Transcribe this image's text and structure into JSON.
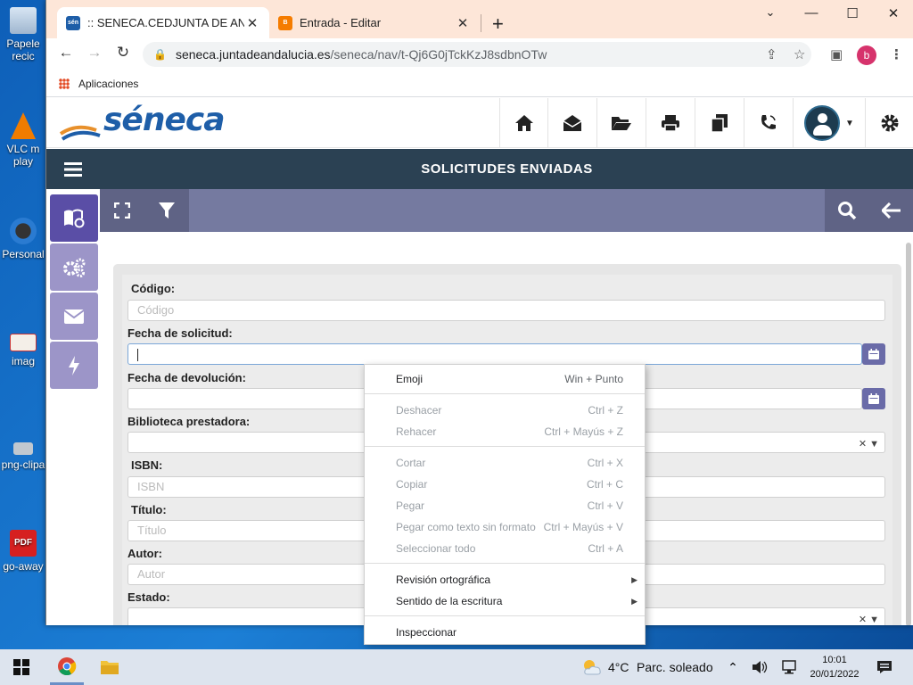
{
  "desktop": {
    "icons": [
      {
        "label": "Papele\nrecic",
        "name": "recycle-bin"
      },
      {
        "label": "VLC m\nplay",
        "name": "vlc-player"
      },
      {
        "label": "Personal",
        "name": "personal"
      },
      {
        "label": "imag",
        "name": "image-file"
      },
      {
        "label": "png-clipa",
        "name": "png-clipart"
      },
      {
        "label": "go-away",
        "name": "pdf-file"
      }
    ]
  },
  "browser": {
    "tabs": [
      {
        "favicon": "sén",
        "title": ":: SENECA.CEDJUNTA DE ANDALUCÍA",
        "active": true
      },
      {
        "favicon": "",
        "title": "Entrada - Editar",
        "active": false
      }
    ],
    "url_host": "seneca.juntadeandalucia.es",
    "url_path": "/seneca/nav/t-Qj6G0jTckKzJ8sdbnOTw",
    "bookmarks_label": "Aplicaciones",
    "profile_initial": "b"
  },
  "app": {
    "logo_text": "séneca",
    "page_title": "SOLICITUDES ENVIADAS",
    "colors": {
      "header_dark": "#2b4153",
      "action_bar": "#757aa0",
      "side_active": "#5a4ea6",
      "side_item": "#9c95c8"
    },
    "form": {
      "codigo_label": "Código:",
      "codigo_placeholder": "Código",
      "fecha_solicitud_label": "Fecha de solicitud:",
      "fecha_devolucion_label": "Fecha de devolución:",
      "biblioteca_label": "Biblioteca prestadora:",
      "isbn_label": "ISBN:",
      "isbn_placeholder": "ISBN",
      "titulo_label": "Título:",
      "titulo_placeholder": "Título",
      "autor_label": "Autor:",
      "autor_placeholder": "Autor",
      "estado_label": "Estado:"
    }
  },
  "context_menu": {
    "emoji": {
      "label": "Emoji",
      "shortcut": "Win + Punto"
    },
    "deshacer": {
      "label": "Deshacer",
      "shortcut": "Ctrl + Z"
    },
    "rehacer": {
      "label": "Rehacer",
      "shortcut": "Ctrl + Mayús + Z"
    },
    "cortar": {
      "label": "Cortar",
      "shortcut": "Ctrl + X"
    },
    "copiar": {
      "label": "Copiar",
      "shortcut": "Ctrl + C"
    },
    "pegar": {
      "label": "Pegar",
      "shortcut": "Ctrl + V"
    },
    "pegar_texto": {
      "label": "Pegar como texto sin formato",
      "shortcut": "Ctrl + Mayús + V"
    },
    "seleccionar": {
      "label": "Seleccionar todo",
      "shortcut": "Ctrl + A"
    },
    "revision": {
      "label": "Revisión ortográfica"
    },
    "sentido": {
      "label": "Sentido de la escritura"
    },
    "inspeccionar": {
      "label": "Inspeccionar"
    }
  },
  "taskbar": {
    "weather_temp": "4°C",
    "weather_text": "Parc. soleado",
    "time": "10:01",
    "date": "20/01/2022"
  }
}
